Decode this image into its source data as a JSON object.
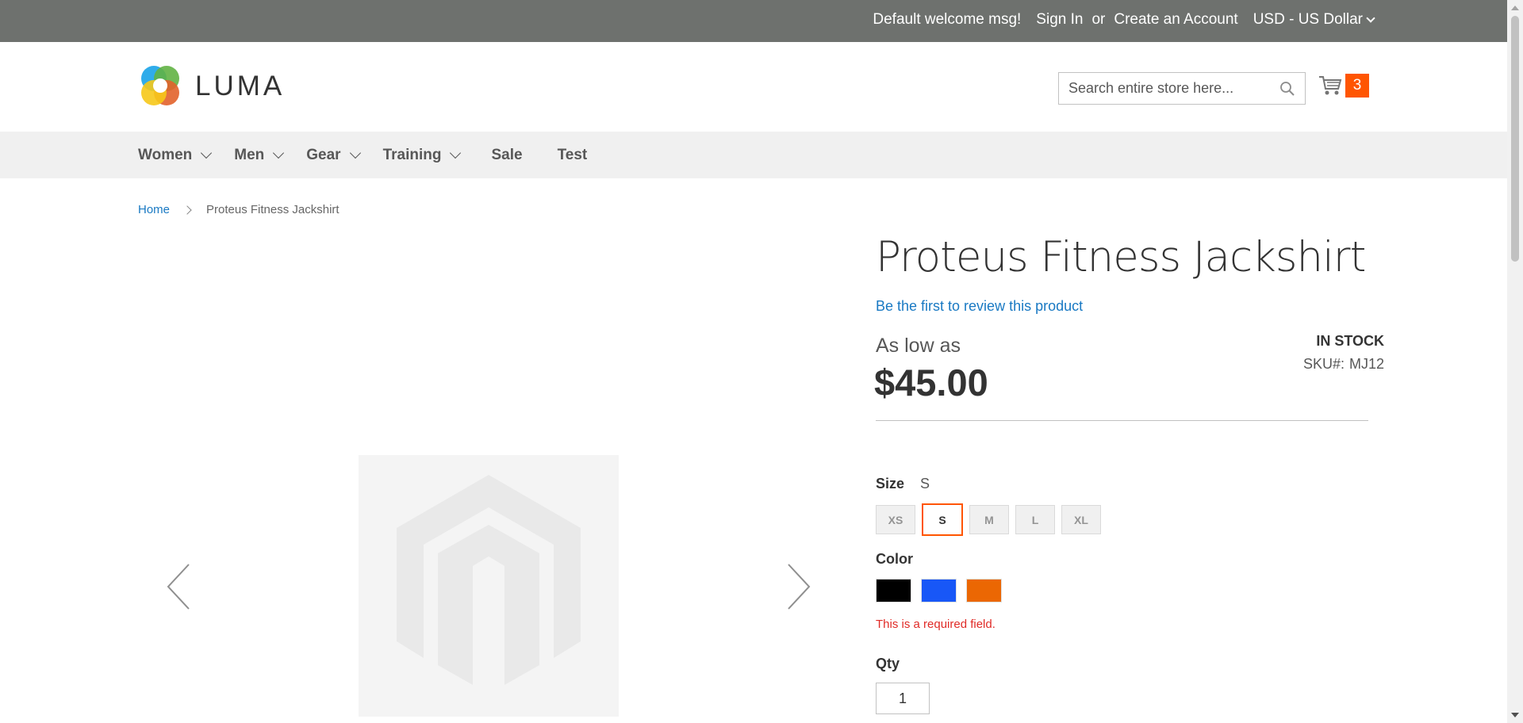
{
  "topbar": {
    "welcome": "Default welcome msg!",
    "sign_in": "Sign In",
    "or": "or",
    "create_account": "Create an Account",
    "currency": "USD - US Dollar"
  },
  "header": {
    "logo_text": "LUMA",
    "search_placeholder": "Search entire store here...",
    "cart_count": "3"
  },
  "nav": {
    "items": [
      {
        "label": "Women",
        "dropdown": true
      },
      {
        "label": "Men",
        "dropdown": true
      },
      {
        "label": "Gear",
        "dropdown": true
      },
      {
        "label": "Training",
        "dropdown": true
      },
      {
        "label": "Sale",
        "dropdown": false
      },
      {
        "label": "Test",
        "dropdown": false
      }
    ]
  },
  "breadcrumb": {
    "home": "Home",
    "current": "Proteus Fitness Jackshirt"
  },
  "product": {
    "title": "Proteus Fitness Jackshirt",
    "review_link": "Be the first to review this product",
    "price_prefix": "As low as",
    "price": "$45.00",
    "stock": "IN STOCK",
    "sku_label": "SKU#:",
    "sku_value": "MJ12",
    "size_label": "Size",
    "size_selected": "S",
    "sizes": [
      "XS",
      "S",
      "M",
      "L",
      "XL"
    ],
    "color_label": "Color",
    "colors": [
      "#000000",
      "#1857f7",
      "#eb6703"
    ],
    "error": "This is a required field.",
    "qty_label": "Qty",
    "qty_value": "1"
  },
  "colors": {
    "topbar_bg": "#6e716e",
    "nav_bg": "#f0f0f0",
    "link": "#1979c3",
    "accent": "#ff5501",
    "error": "#e02b27"
  }
}
